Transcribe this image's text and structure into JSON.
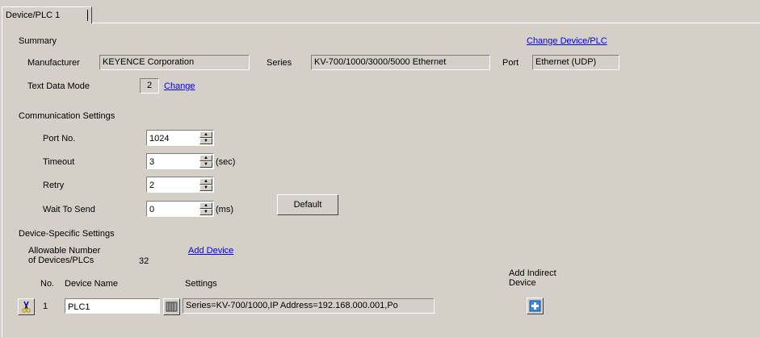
{
  "tab": {
    "label": "Device/PLC 1"
  },
  "summary": {
    "heading": "Summary",
    "change_device_link": "Change Device/PLC",
    "manufacturer_label": "Manufacturer",
    "manufacturer_value": "KEYENCE Corporation",
    "series_label": "Series",
    "series_value": "KV-700/1000/3000/5000 Ethernet",
    "port_label": "Port",
    "port_value": "Ethernet (UDP)",
    "text_mode_label": "Text Data Mode",
    "text_mode_value": "2",
    "change_link": "Change"
  },
  "comm": {
    "heading": "Communication Settings",
    "port_label": "Port No.",
    "port_value": "1024",
    "timeout_label": "Timeout",
    "timeout_value": "3",
    "timeout_unit": "(sec)",
    "retry_label": "Retry",
    "retry_value": "2",
    "wait_label": "Wait To Send",
    "wait_value": "0",
    "wait_unit": "(ms)",
    "default_button": "Default"
  },
  "device": {
    "heading": "Device-Specific Settings",
    "allowable_line1": "Allowable Number",
    "allowable_line2": "of Devices/PLCs",
    "allowable_value": "32",
    "add_device_link": "Add Device",
    "col_no": "No.",
    "col_name": "Device Name",
    "col_settings": "Settings",
    "col_indirect_line1": "Add Indirect",
    "col_indirect_line2": "Device",
    "rows": [
      {
        "no": "1",
        "name": "PLC1",
        "settings": "Series=KV-700/1000,IP Address=192.168.000.001,Po"
      }
    ]
  },
  "colors": {
    "background": "#d4d0c8",
    "link": "#0000ff"
  }
}
